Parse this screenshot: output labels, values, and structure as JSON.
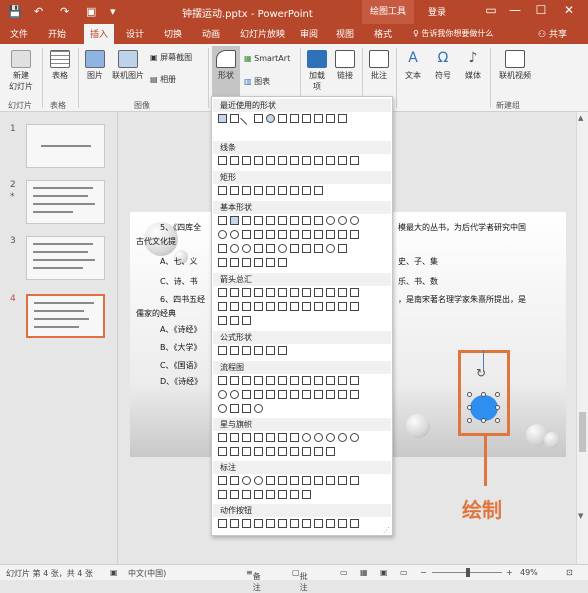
{
  "window": {
    "title": "钟摆运动.pptx - PowerPoint",
    "tool_tab": "绘图工具",
    "login": "登录",
    "share": "共享"
  },
  "tabs": [
    "文件",
    "开始",
    "插入",
    "设计",
    "切换",
    "动画",
    "幻灯片放映",
    "审阅",
    "视图",
    "格式"
  ],
  "tell": "告诉我你想要做什么",
  "ribbon": {
    "groups": {
      "slides": "幻灯片",
      "tables": "表格",
      "images": "图像",
      "new_group": "新建组"
    },
    "buttons": {
      "new_slide": "新建\n幻灯片",
      "table": "表格",
      "picture": "图片",
      "online_picture": "联机图片",
      "screenshot": "屏幕截图",
      "album": "相册",
      "shapes": "形状",
      "smartart": "SmartArt",
      "chart": "图表",
      "addin": "加载\n项",
      "link": "链接",
      "comment": "批注",
      "text": "文本",
      "symbol": "符号",
      "media": "媒体",
      "online_video": "联机视频"
    }
  },
  "thumbs": [
    {
      "num": "1"
    },
    {
      "num": "2",
      "star": "*"
    },
    {
      "num": "3"
    },
    {
      "num": "4"
    }
  ],
  "slide": {
    "lines": [
      "5、《四库全",
      "古代文化提",
      "A、七、义",
      "C、诗、书",
      "6、四书五经",
      "儒家的经典",
      "A、《诗经》",
      "B、《大学》",
      "C、《国语》",
      "D、《诗经》"
    ],
    "right_lines": [
      "模最大的丛书，为后代学者研究中国",
      "史、子、集",
      "乐、书、数",
      "，是南宋著名理学家朱熹所提出，是"
    ]
  },
  "dropdown": {
    "sections": [
      "最近使用的形状",
      "线条",
      "矩形",
      "基本形状",
      "箭头总汇",
      "公式形状",
      "流程图",
      "星与旗帜",
      "标注",
      "动作按钮"
    ]
  },
  "callout": "绘制",
  "status": {
    "slide": "幻灯片 第 4 张，共 4 张",
    "lang": "中文(中国)",
    "notes": "备注",
    "comments": "批注",
    "zoom": "49%"
  }
}
